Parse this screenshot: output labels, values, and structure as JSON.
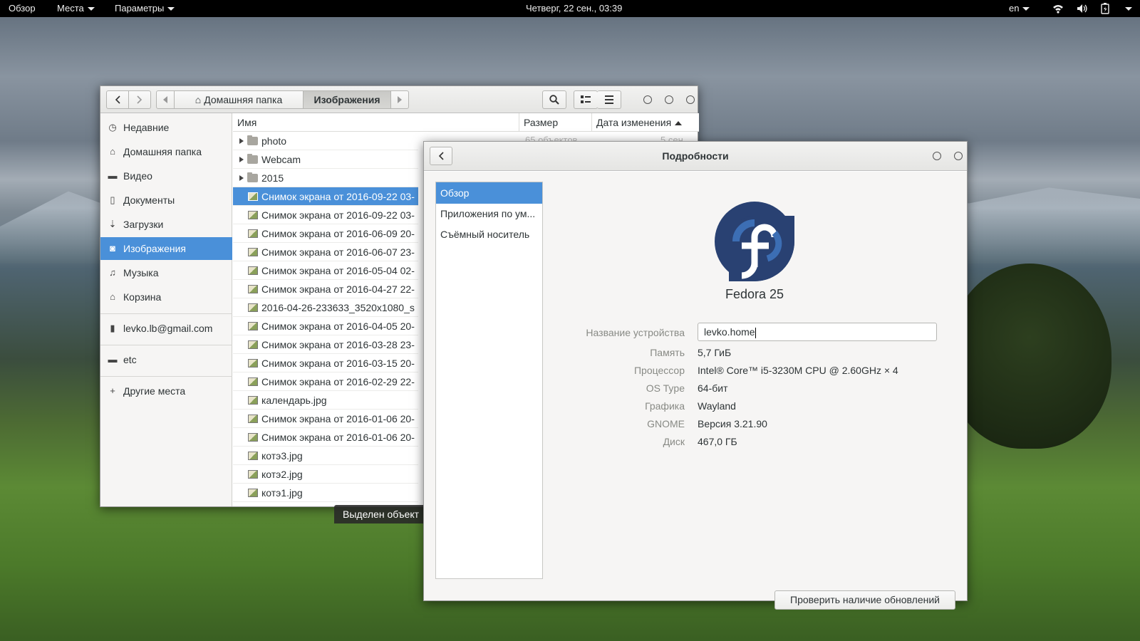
{
  "topbar": {
    "activities": "Обзор",
    "places": "Места",
    "settings": "Параметры",
    "clock": "Четверг, 22 сен., 03:39",
    "lang": "en"
  },
  "files": {
    "path": {
      "home": "Домашняя папка",
      "current": "Изображения"
    },
    "sidebar": [
      {
        "label": "Недавние",
        "icon": "clock-icon"
      },
      {
        "label": "Домашняя папка",
        "icon": "home-icon"
      },
      {
        "label": "Видео",
        "icon": "video-icon"
      },
      {
        "label": "Документы",
        "icon": "document-icon"
      },
      {
        "label": "Загрузки",
        "icon": "download-icon"
      },
      {
        "label": "Изображения",
        "icon": "camera-icon",
        "selected": true
      },
      {
        "label": "Музыка",
        "icon": "music-icon"
      },
      {
        "label": "Корзина",
        "icon": "trash-icon"
      },
      {
        "label": "levko.lb@gmail.com",
        "icon": "phone-icon"
      },
      {
        "label": "etc",
        "icon": "folder-icon"
      },
      {
        "label": "Другие места",
        "icon": "plus-icon"
      }
    ],
    "columns": {
      "name": "Имя",
      "size": "Размер",
      "modified": "Дата изменения"
    },
    "partial_row": {
      "size": "65 объектов",
      "modified": "5 сен"
    },
    "rows": [
      {
        "name": "photo",
        "type": "folder"
      },
      {
        "name": "Webcam",
        "type": "folder"
      },
      {
        "name": "2015",
        "type": "folder"
      },
      {
        "name": "Снимок экрана от 2016-09-22 03-",
        "type": "image",
        "selected": true
      },
      {
        "name": "Снимок экрана от 2016-09-22 03-",
        "type": "image"
      },
      {
        "name": "Снимок экрана от 2016-06-09 20-",
        "type": "image"
      },
      {
        "name": "Снимок экрана от 2016-06-07 23-",
        "type": "image"
      },
      {
        "name": "Снимок экрана от 2016-05-04 02-",
        "type": "image"
      },
      {
        "name": "Снимок экрана от 2016-04-27 22-",
        "type": "image"
      },
      {
        "name": "2016-04-26-233633_3520x1080_s",
        "type": "image"
      },
      {
        "name": "Снимок экрана от 2016-04-05 20-",
        "type": "image"
      },
      {
        "name": "Снимок экрана от 2016-03-28 23-",
        "type": "image"
      },
      {
        "name": "Снимок экрана от 2016-03-15 20-",
        "type": "image"
      },
      {
        "name": "Снимок экрана от 2016-02-29 22-",
        "type": "image"
      },
      {
        "name": "календарь.jpg",
        "type": "image"
      },
      {
        "name": "Снимок экрана от 2016-01-06 20-",
        "type": "image"
      },
      {
        "name": "Снимок экрана от 2016-01-06 20-",
        "type": "image"
      },
      {
        "name": "котэ3.jpg",
        "type": "image"
      },
      {
        "name": "котэ2.jpg",
        "type": "image"
      },
      {
        "name": "котэ1.jpg",
        "type": "image"
      }
    ],
    "status": "Выделен объект"
  },
  "details": {
    "title": "Подробности",
    "sidebar": [
      {
        "label": "Обзор",
        "selected": true
      },
      {
        "label": "Приложения по ум..."
      },
      {
        "label": "Съёмный носитель"
      }
    ],
    "os_name": "Fedora 25",
    "device_label": "Название устройства",
    "device_value": "levko.home",
    "info": [
      {
        "label": "Память",
        "value": "5,7 ГиБ"
      },
      {
        "label": "Процессор",
        "value": "Intel® Core™ i5-3230M CPU @ 2.60GHz × 4"
      },
      {
        "label": "OS Type",
        "value": "64-бит"
      },
      {
        "label": "Графика",
        "value": "Wayland"
      },
      {
        "label": "GNOME",
        "value": "Версия 3.21.90"
      },
      {
        "label": "Диск",
        "value": "467,0 ГБ"
      }
    ],
    "update_button": "Проверить наличие обновлений"
  },
  "colors": {
    "accent": "#4a90d9",
    "fedora": "#294172",
    "fedora_light": "#3c6eb4"
  }
}
